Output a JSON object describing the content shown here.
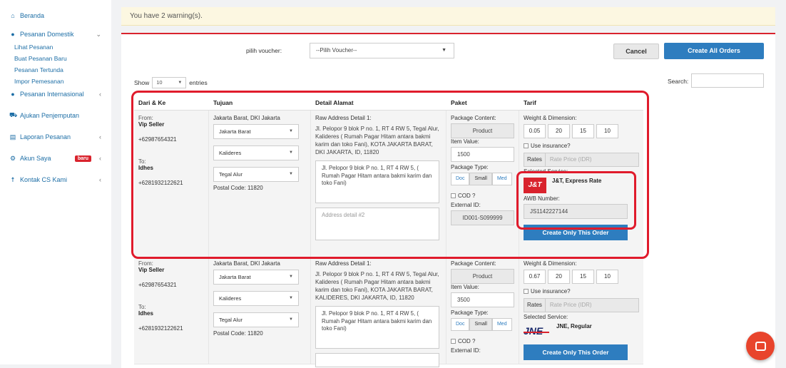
{
  "sidebar": {
    "items": [
      {
        "label": "Beranda",
        "icon": "home-icon",
        "glyph": "⌂"
      },
      {
        "label": "Pesanan Domestik",
        "icon": "circle-plus-icon",
        "glyph": "●"
      },
      {
        "label": "Pesanan Internasional",
        "icon": "circle-plus-icon",
        "glyph": "●"
      },
      {
        "label": "Ajukan Penjemputan",
        "icon": "truck-icon",
        "glyph": "⛟"
      },
      {
        "label": "Laporan Pesanan",
        "icon": "file-icon",
        "glyph": "▤"
      },
      {
        "label": "Akun Saya",
        "icon": "gear-icon",
        "glyph": "⚙"
      },
      {
        "label": "Kontak CS Kami",
        "icon": "user-icon",
        "glyph": "☨"
      }
    ],
    "subitems": [
      "Lihat Pesanan",
      "Buat Pesanan Baru",
      "Pesanan Tertunda",
      "Impor Pemesanan"
    ],
    "badge": "baru",
    "caret_right": "‹",
    "caret_down": "⌄"
  },
  "warning": "You have 2 warning(s).",
  "voucher": {
    "label": "pilih voucher:",
    "value": "--Pilih Voucher--"
  },
  "buttons": {
    "cancel": "Cancel",
    "create_all": "Create All Orders",
    "create_one": "Create Only This Order"
  },
  "table_controls": {
    "show": "Show",
    "entries_value": "10",
    "entries": "entries",
    "search": "Search:"
  },
  "columns": [
    "Dari & Ke",
    "Tujuan",
    "Detail Alamat",
    "Paket",
    "Tarif"
  ],
  "labels": {
    "from": "From:",
    "to": "To:",
    "raw_address": "Raw Address Detail 1:",
    "package_content": "Package Content:",
    "item_value": "Item Value:",
    "package_type": "Package Type:",
    "cod": "COD ?",
    "external_id": "External ID:",
    "weight_dim": "Weight & Dimension:",
    "insurance": "Use insurance?",
    "rates": "Rates",
    "rate_price": "Rate Price (IDR)",
    "selected_service": "Selected Service:",
    "awb_number": "AWB Number:",
    "address2_placeholder": "Address detail #2",
    "pkg_types": [
      "Doc",
      "Small",
      "Med"
    ],
    "arrow": "▼"
  },
  "orders": [
    {
      "sender": "Vip Seller",
      "sender_phone": "+62987654321",
      "recipient": "Idhes",
      "recipient_phone": "+6281932122621",
      "region": "Jakarta Barat, DKI Jakarta",
      "city": "Jakarta Barat",
      "district": "Kalideres",
      "subdistrict": "Tegal Alur",
      "postal": "Postal Code: 11820",
      "raw_address": "Jl. Pelopor 9 blok P no. 1, RT 4 RW 5, Tegal Alur, Kalideres ( Rumah Pagar Hitam antara bakmi karim dan toko Fani), KOTA JAKARTA BARAT, DKI JAKARTA, ID, 11820",
      "address1": "Jl. Pelopor 9 blok P no. 1, RT 4 RW 5, ( Rumah Pagar Hitam antara bakmi karim dan toko Fani)",
      "content": "Product",
      "item_value": "1500",
      "external_id": "ID001-S099999",
      "weight": "0.05",
      "l": "20",
      "w": "15",
      "h": "10",
      "service": "J&T, Express Rate",
      "logo": "J&T",
      "awb": "JS1142227144"
    },
    {
      "sender": "Vip Seller",
      "sender_phone": "+62987654321",
      "recipient": "Idhes",
      "recipient_phone": "+6281932122621",
      "region": "Jakarta Barat, DKI Jakarta",
      "city": "Jakarta Barat",
      "district": "Kalideres",
      "subdistrict": "Tegal Alur",
      "postal": "Postal Code: 11820",
      "raw_address": "Jl. Pelopor 9 blok P no. 1, RT 4 RW 5, Tegal Alur, Kalideres ( Rumah Pagar Hitam antara bakmi karim dan toko Fani), KOTA JAKARTA BARAT, KALIDERES, DKI JAKARTA, ID, 11820",
      "address1": "Jl. Pelopor 9 blok P no. 1, RT 4 RW 5, ( Rumah Pagar Hitam antara bakmi karim dan toko Fani)",
      "content": "Product",
      "item_value": "3500",
      "weight": "0.67",
      "l": "20",
      "w": "15",
      "h": "10",
      "service": "JNE, Regular",
      "logo": "JNE"
    }
  ],
  "colors": {
    "accent": "#2e7dbf",
    "highlight": "#e01b2c",
    "warning_bg": "#fcf7e1"
  }
}
